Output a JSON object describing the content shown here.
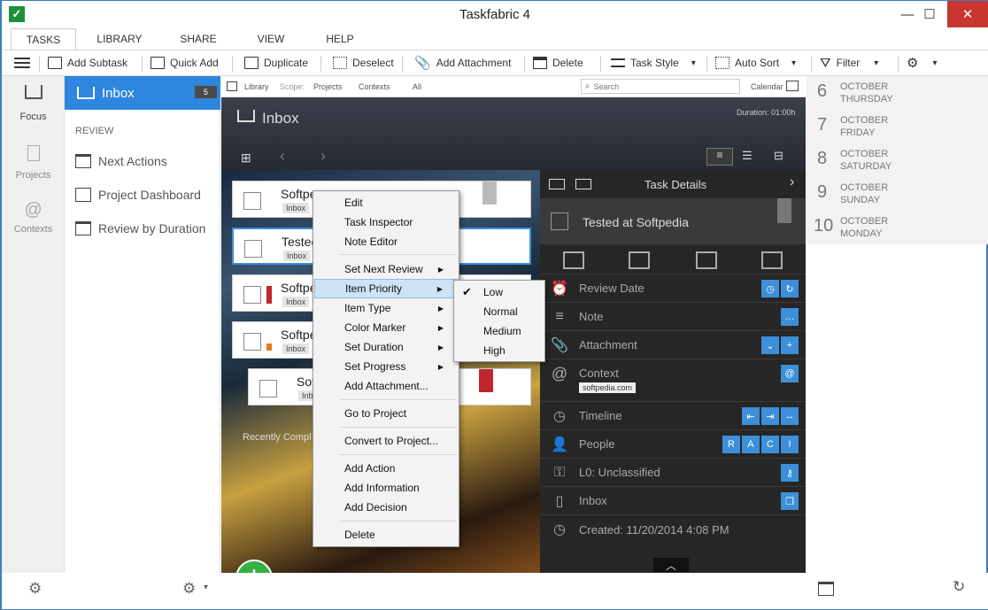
{
  "window": {
    "title": "Taskfabric 4",
    "minimize": "—",
    "maximize": "☐",
    "close": "✕"
  },
  "ribbon_tabs": [
    "TASKS",
    "LIBRARY",
    "SHARE",
    "VIEW",
    "HELP"
  ],
  "toolbar": {
    "add_subtask": "Add Subtask",
    "quick_add": "Quick Add",
    "duplicate": "Duplicate",
    "deselect": "Deselect",
    "add_attachment": "Add Attachment",
    "delete": "Delete",
    "task_style": "Task Style",
    "auto_sort": "Auto Sort",
    "filter": "Filter"
  },
  "leftnav": {
    "focus": "Focus",
    "projects": "Projects",
    "contexts": "Contexts"
  },
  "sidebar": {
    "inbox": "Inbox",
    "inbox_count": "5",
    "review_header": "REVIEW",
    "items": [
      "Next Actions",
      "Project Dashboard",
      "Review by Duration"
    ]
  },
  "filterbar": {
    "library": "Library",
    "scope": "Scope:",
    "projects": "Projects",
    "contexts": "Contexts",
    "all": "All",
    "search_placeholder": "Search",
    "calendar": "Calendar"
  },
  "main": {
    "title": "Inbox",
    "duration": "Duration: 01:00h",
    "recently_completed": "Recently Compl"
  },
  "tasks": [
    {
      "title": "Softpe",
      "tag": "Inbox"
    },
    {
      "title": "Testec",
      "tag": "Inbox"
    },
    {
      "title": "Softpe",
      "tag": "Inbox"
    },
    {
      "title": "Softpe",
      "tag": "Inbox"
    },
    {
      "title": "Soft",
      "tag": "Inb"
    }
  ],
  "context_menu": {
    "items": [
      "Edit",
      "Task Inspector",
      "Note Editor",
      "Set Next Review",
      "Item Priority",
      "Item Type",
      "Color Marker",
      "Set Duration",
      "Set Progress",
      "Add Attachment...",
      "Go to Project",
      "Convert to Project...",
      "Add Action",
      "Add Information",
      "Add Decision",
      "Delete"
    ]
  },
  "priority_submenu": {
    "items": [
      "Low",
      "Normal",
      "Medium",
      "High"
    ],
    "selected": "Low"
  },
  "details": {
    "header": "Task Details",
    "task_title": "Tested at Softpedia",
    "review_date": "Review Date",
    "note": "Note",
    "attachment": "Attachment",
    "context": "Context",
    "context_tag": "softpedia.com",
    "timeline": "Timeline",
    "people": "People",
    "raci": [
      "R",
      "A",
      "C",
      "I"
    ],
    "classification": "L0: Unclassified",
    "inbox": "Inbox",
    "created": "Created: 11/20/2014 4:08 PM"
  },
  "calendar": [
    {
      "day": "6",
      "month": "OCTOBER",
      "weekday": "THURSDAY"
    },
    {
      "day": "7",
      "month": "OCTOBER",
      "weekday": "FRIDAY"
    },
    {
      "day": "8",
      "month": "OCTOBER",
      "weekday": "SATURDAY"
    },
    {
      "day": "9",
      "month": "OCTOBER",
      "weekday": "SUNDAY"
    },
    {
      "day": "10",
      "month": "OCTOBER",
      "weekday": "MONDAY"
    }
  ],
  "colors": {
    "accent": "#3d8fd9",
    "selection": "#2e86de",
    "priority_high": "#c0262c",
    "priority_medium": "#e07b1a"
  }
}
